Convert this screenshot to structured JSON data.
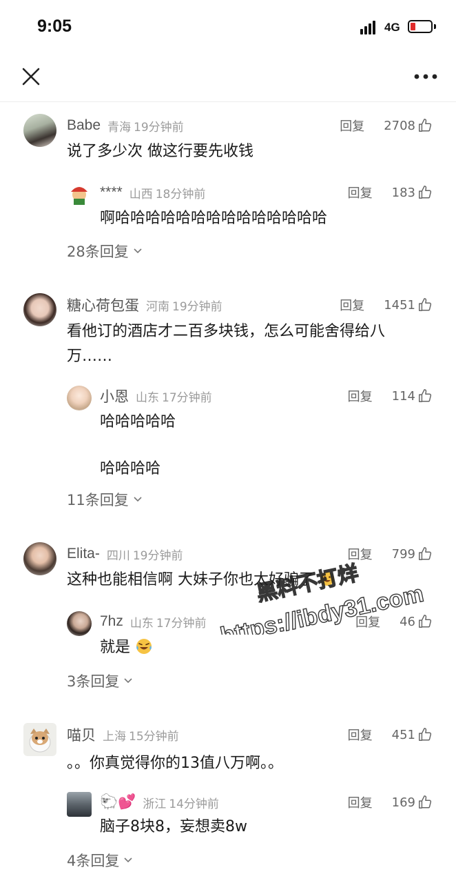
{
  "status_bar": {
    "time": "9:05",
    "network": "4G",
    "battery_color": "#e02c2c"
  },
  "nav": {
    "close_icon": "close-icon",
    "more_icon": "more-icon"
  },
  "comments": [
    {
      "username": "Babe",
      "location": "青海",
      "time": "19分钟前",
      "reply_label": "回复",
      "likes": "2708",
      "text": "说了多少次 做这行要先收钱",
      "reply": {
        "username": "****",
        "location": "山西",
        "time": "18分钟前",
        "reply_label": "回复",
        "likes": "183",
        "text": "啊哈哈哈哈哈哈哈哈哈哈哈哈哈哈"
      },
      "more_replies": "28条回复"
    },
    {
      "username": "糖心荷包蛋",
      "location": "河南",
      "time": "19分钟前",
      "reply_label": "回复",
      "likes": "1451",
      "text": "看他订的酒店才二百多块钱，怎么可能舍得给八万……",
      "reply": {
        "username": "小恩",
        "location": "山东",
        "time": "17分钟前",
        "reply_label": "回复",
        "likes": "114",
        "text_line1": "哈哈哈哈哈",
        "text_line2": "哈哈哈哈"
      },
      "more_replies": "11条回复"
    },
    {
      "username": "Elita-",
      "location": "四川",
      "time": "19分钟前",
      "reply_label": "回复",
      "likes": "799",
      "text": "这种也能相信啊 大妹子你也太好骗了",
      "text_emoji": "grinning-sweat-emoji",
      "reply": {
        "username": "7hz",
        "location": "山东",
        "time": "17分钟前",
        "reply_label": "回复",
        "likes": "46",
        "text": "就是",
        "text_emoji": "laughing-tears-emoji"
      },
      "more_replies": "3条回复"
    },
    {
      "username": "喵贝",
      "location": "上海",
      "time": "15分钟前",
      "reply_label": "回复",
      "likes": "451",
      "text": "。。你真觉得你的13值八万啊。。",
      "reply": {
        "username": "🐑💕",
        "location": "浙江",
        "time": "14分钟前",
        "reply_label": "回复",
        "likes": "169",
        "text": "脑子8块8，妄想卖8w"
      },
      "more_replies": "4条回复"
    }
  ],
  "watermark": {
    "line1": "黑料不打烊",
    "line2": "https://ibdy31.com"
  }
}
